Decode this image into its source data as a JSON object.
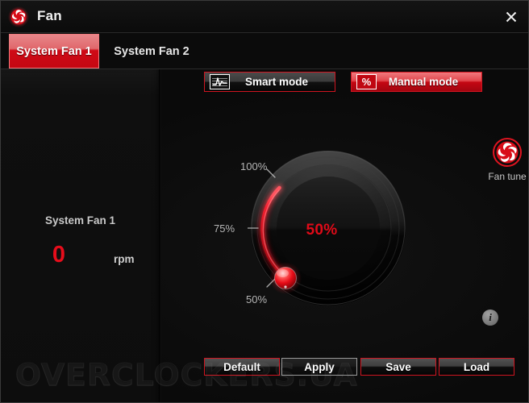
{
  "window": {
    "title": "Fan",
    "logo_icon": "fan-aperture-icon",
    "close_icon": "close-icon"
  },
  "tabs": [
    {
      "label": "System Fan 1",
      "active": true
    },
    {
      "label": "System Fan 2",
      "active": false
    }
  ],
  "left_panel": {
    "fan_name": "System Fan 1",
    "rpm_value": "0",
    "rpm_unit": "rpm"
  },
  "modes": {
    "smart": {
      "label": "Smart mode",
      "icon": "waveform-icon",
      "selected": false
    },
    "manual": {
      "label": "Manual mode",
      "icon": "percent-icon",
      "selected": true
    }
  },
  "dial": {
    "center_value": "50%",
    "ticks": [
      {
        "label": "100%"
      },
      {
        "label": "75%"
      },
      {
        "label": "50%"
      }
    ]
  },
  "fan_tune": {
    "label": "Fan tune",
    "icon": "fan-aperture-icon"
  },
  "info": {
    "icon": "info-icon",
    "glyph": "i"
  },
  "buttons": [
    {
      "label": "Default"
    },
    {
      "label": "Apply"
    },
    {
      "label": "Save"
    },
    {
      "label": "Load"
    }
  ],
  "watermark": "OVERCLOCKERS.UA",
  "colors": {
    "accent_red": "#cf1520",
    "value_red": "#e00a18",
    "background": "#0a0a0a"
  }
}
